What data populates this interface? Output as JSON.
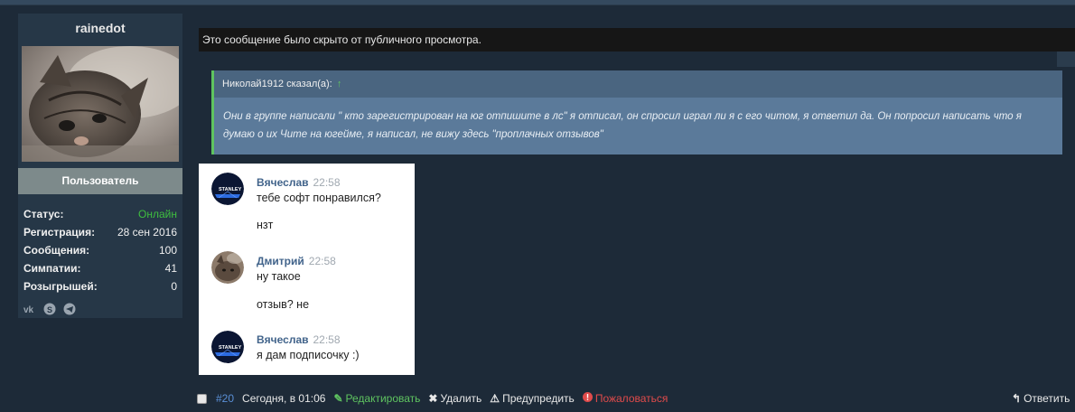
{
  "user": {
    "name": "rainedot",
    "role": "Пользователь",
    "stats": [
      {
        "label": "Статус:",
        "value": "Онлайн",
        "status": "online"
      },
      {
        "label": "Регистрация:",
        "value": "28 сен 2016"
      },
      {
        "label": "Сообщения:",
        "value": "100"
      },
      {
        "label": "Симпатии:",
        "value": "41"
      },
      {
        "label": "Розыгрышей:",
        "value": "0"
      }
    ],
    "socials": [
      "vk-icon",
      "skype-icon",
      "telegram-icon"
    ]
  },
  "post": {
    "hidden_notice": "Это сообщение было скрыто от публичного просмотра.",
    "quote": {
      "author": "Николай1912 сказал(а):",
      "arrow": "↑",
      "text": "Они в группе написали \" кто зарегистрирован на юг отпишите в лс\" я отписал, он спросил играл ли я с его читом, я ответил да. Он попросил написать что я думаю о их Чите на югейме, я написал, не вижу здесь \"проплачных отзывов\""
    },
    "chat": [
      {
        "name": "Вячеслав",
        "time": "22:58",
        "lines": [
          "тебе софт понравился?",
          "нзт"
        ]
      },
      {
        "name": "Дмитрий",
        "time": "22:58",
        "lines": [
          "ну такое",
          "отзыв? не"
        ]
      },
      {
        "name": "Вячеслав",
        "time": "22:58",
        "lines": [
          "я дам подписочку :)"
        ]
      }
    ],
    "footer": {
      "post_number": "#20",
      "date": "Сегодня, в 01:06",
      "edit": "Редактировать",
      "delete": "Удалить",
      "warn": "Предупредить",
      "report": "Пожаловаться",
      "reply": "Ответить"
    }
  },
  "colors": {
    "online": "#3fbf3f",
    "quote_border": "#5fc460",
    "link": "#5a8fd6",
    "report": "#e04b4b",
    "chat_name": "#42648b"
  }
}
